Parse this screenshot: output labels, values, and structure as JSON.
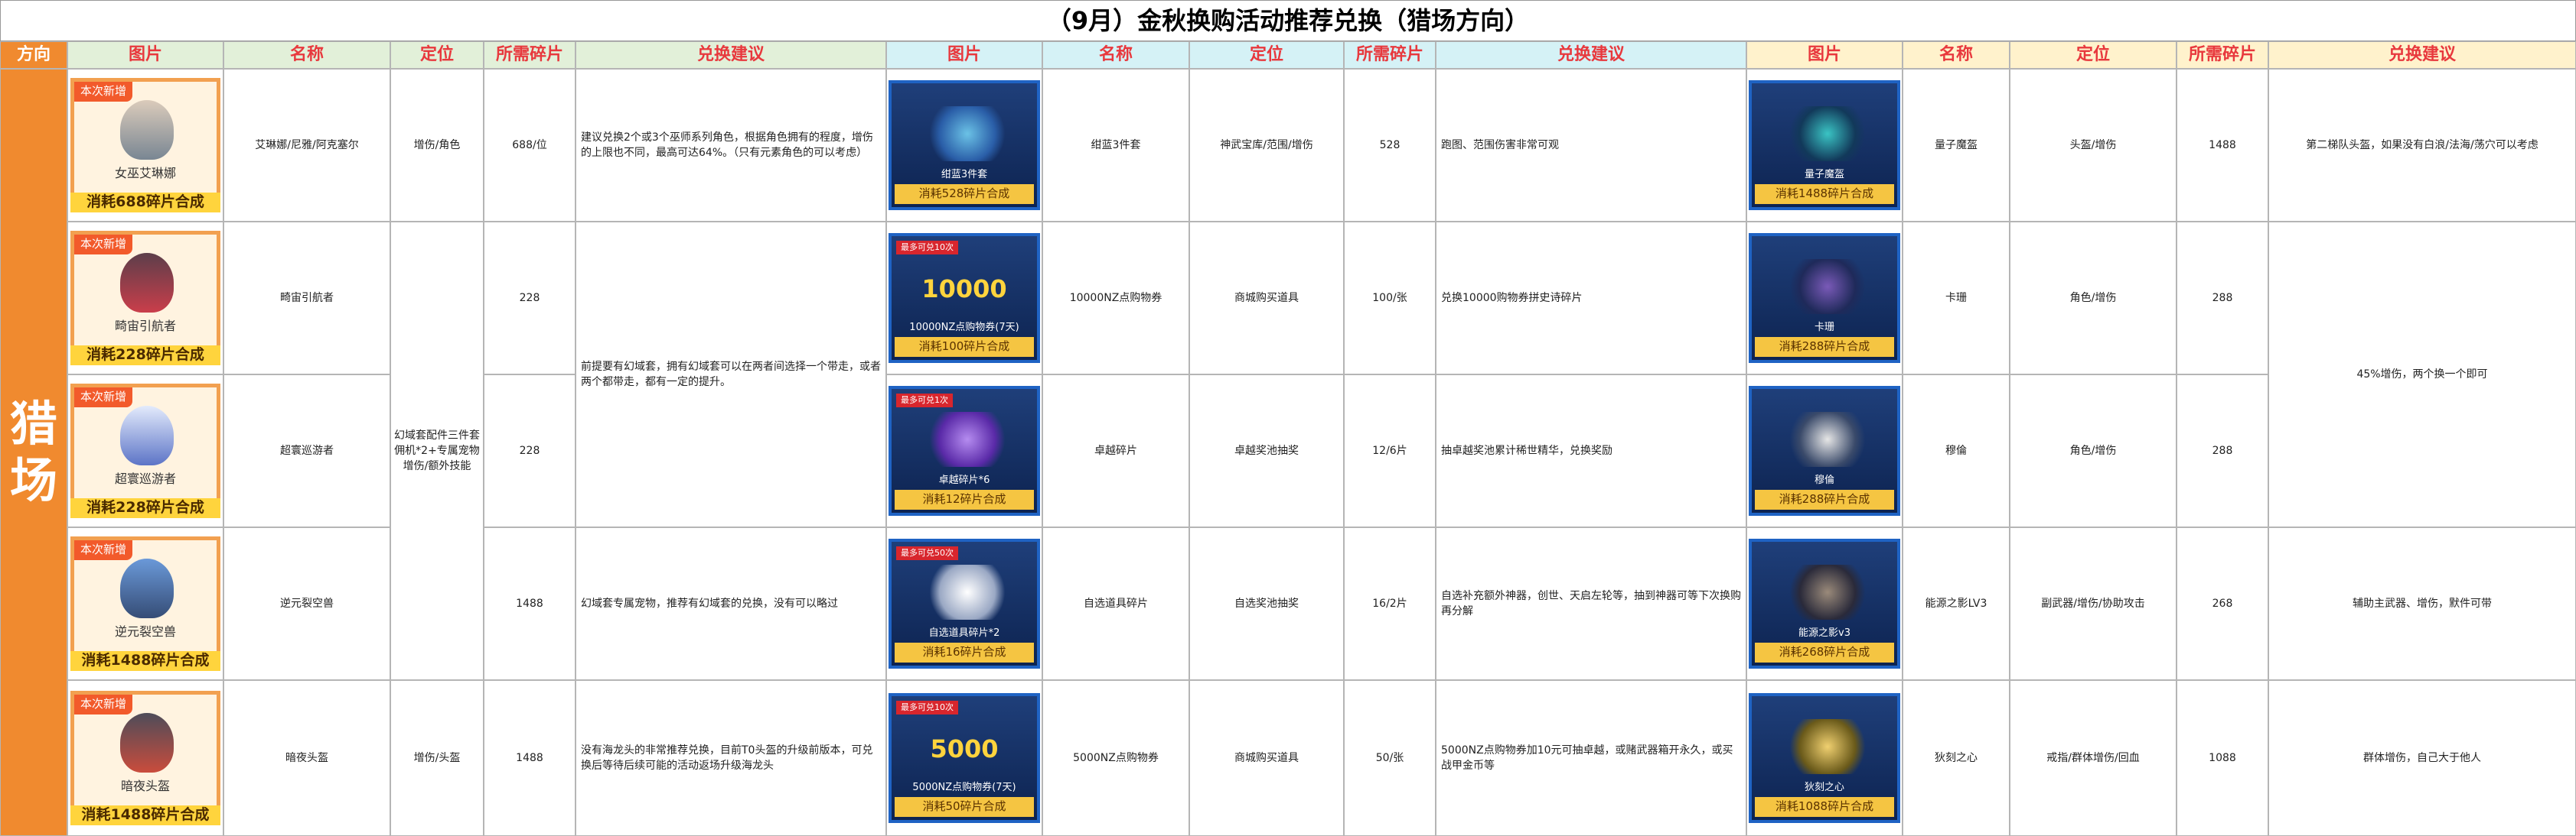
{
  "title": "（9月）金秋换购活动推荐兑换（猎场方向）",
  "headers": {
    "direction": "方向",
    "group1": [
      "图片",
      "名称",
      "定位",
      "所需碎片",
      "兑换建议"
    ],
    "group2": [
      "图片",
      "名称",
      "定位",
      "所需碎片",
      "兑换建议"
    ],
    "group3": [
      "图片",
      "名称",
      "定位",
      "所需碎片",
      "兑换建议"
    ]
  },
  "side_label": [
    "猎",
    "场"
  ],
  "group1": {
    "new_badge": "本次新增",
    "items": [
      {
        "card_name": "女巫艾琳娜",
        "card_footer": "消耗688碎片合成",
        "name": "艾琳娜/尼雅/阿克塞尔",
        "position": "增伤/角色",
        "cost": "688/位",
        "advice": "建议兑换2个或3个巫师系列角色，根据角色拥有的程度，增伤的上限也不同，最高可达64%。（只有元素角色的可以考虑）"
      },
      {
        "card_name": "畸宙引航者",
        "card_footer": "消耗228碎片合成",
        "name": "畸宙引航者",
        "position": "",
        "cost": "228",
        "advice": ""
      },
      {
        "card_name": "超寰巡游者",
        "card_footer": "消耗228碎片合成",
        "name": "超寰巡游者",
        "position": "",
        "cost": "228",
        "advice": ""
      },
      {
        "card_name": "逆元裂空兽",
        "card_footer": "消耗1488碎片合成",
        "name": "逆元裂空兽",
        "position": "",
        "cost": "1488",
        "advice": "幻域套专属宠物，推荐有幻域套的兑换，没有可以略过"
      },
      {
        "card_name": "暗夜头盔",
        "card_footer": "消耗1488碎片合成",
        "name": "暗夜头盔",
        "position": "增伤/头盔",
        "cost": "1488",
        "advice": "没有海龙头的非常推荐兑换，目前T0头盔的升级前版本，可兑换后等待后续可能的活动返场升级海龙头"
      }
    ],
    "merged_position": "幻域套配件三件套\n佣机*2+专属宠物\n增伤/额外技能",
    "merged_advice": "前提要有幻域套，拥有幻域套可以在两者间选择一个带走，或者两个都带走，都有一定的提升。"
  },
  "group2": {
    "items": [
      {
        "tag": "",
        "big": "",
        "card_name": "绀蓝3件套",
        "card_footer": "消耗528碎片合成",
        "name": "绀蓝3件套",
        "position": "神武宝库/范围/增伤",
        "cost": "528",
        "advice": "跑图、范围伤害非常可观"
      },
      {
        "tag": "最多可兑10次",
        "big": "10000",
        "card_name": "10000NZ点购物券(7天)",
        "card_footer": "消耗100碎片合成",
        "name": "10000NZ点购物券",
        "position": "商城购买道具",
        "cost": "100/张",
        "advice": "兑换10000购物券拼史诗碎片"
      },
      {
        "tag": "最多可兑1次",
        "big": "",
        "card_name": "卓越碎片*6",
        "card_footer": "消耗12碎片合成",
        "name": "卓越碎片",
        "position": "卓越奖池抽奖",
        "cost": "12/6片",
        "advice": "抽卓越奖池累计稀世精华，兑换奖励"
      },
      {
        "tag": "最多可兑50次",
        "big": "",
        "card_name": "自选道具碎片*2",
        "card_footer": "消耗16碎片合成",
        "name": "自选道具碎片",
        "position": "自选奖池抽奖",
        "cost": "16/2片",
        "advice": "自选补充额外神器，创世、天启左轮等，抽到神器可等下次换购再分解"
      },
      {
        "tag": "最多可兑10次",
        "big": "5000",
        "card_name": "5000NZ点购物券(7天)",
        "card_footer": "消耗50碎片合成",
        "name": "5000NZ点购物券",
        "position": "商城购买道具",
        "cost": "50/张",
        "advice": "5000NZ点购物券加10元可抽卓越，或赌武器箱开永久，或买战甲金币等"
      }
    ]
  },
  "group3": {
    "items": [
      {
        "card_name": "量子魔盔",
        "card_footer": "消耗1488碎片合成",
        "name": "量子魔盔",
        "position": "头盔/增伤",
        "cost": "1488",
        "advice": "第二梯队头盔，如果没有白浪/法海/荡穴可以考虑"
      },
      {
        "card_name": "卡珊",
        "card_footer": "消耗288碎片合成",
        "name": "卡珊",
        "position": "角色/增伤",
        "cost": "288",
        "advice": ""
      },
      {
        "card_name": "穆倫",
        "card_footer": "消耗288碎片合成",
        "name": "穆倫",
        "position": "角色/增伤",
        "cost": "288",
        "advice": ""
      },
      {
        "card_name": "能源之影v3",
        "card_footer": "消耗268碎片合成",
        "name": "能源之影LV3",
        "position": "副武器/增伤/协助攻击",
        "cost": "268",
        "advice": "辅助主武器、增伤，默件可带"
      },
      {
        "card_name": "狄刻之心",
        "card_footer": "消耗1088碎片合成",
        "name": "狄刻之心",
        "position": "戒指/群体增伤/回血",
        "cost": "1088",
        "advice": "群体增伤，自己大于他人"
      }
    ],
    "merged_advice": "45%增伤，两个换一个即可"
  },
  "colors": {
    "orange": "#f08a2f",
    "red_text": "#e8383d",
    "green_hdr": "#e2f0d9",
    "blue_hdr": "#d5f2f6",
    "yellow_hdr": "#fff2cc"
  }
}
